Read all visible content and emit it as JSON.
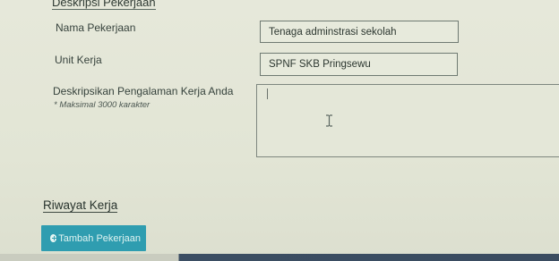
{
  "section": {
    "heading": "Deskripsi Pekerjaan"
  },
  "form": {
    "nama_label": "Nama Pekerjaan",
    "nama_value": "Tenaga adminstrasi sekolah",
    "unit_label": "Unit Kerja",
    "unit_value": "SPNF SKB Pringsewu",
    "deskripsi_label": "Deskripsikan Pengalaman Kerja Anda",
    "deskripsi_hint": "* Maksimal 3000 karakter",
    "deskripsi_value": ""
  },
  "riwayat": {
    "heading": "Riwayat Kerja",
    "add_button_label": "Tambah Pekerjaan"
  },
  "colors": {
    "background": "#e2e5d6",
    "button": "#2f9db0",
    "taskbar": "#3b4e63"
  }
}
